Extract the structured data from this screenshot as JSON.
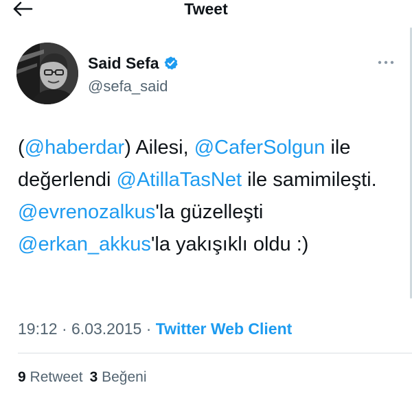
{
  "header": {
    "title": "Tweet",
    "back_icon": "arrow-left-icon"
  },
  "author": {
    "display_name": "Said Sefa",
    "handle": "@sefa_said",
    "verified_icon": "verified-badge-icon",
    "verified_color": "#1d9bf0",
    "more_icon": "more-horizontal-icon"
  },
  "tweet": {
    "segments": [
      {
        "text": "(",
        "mention": false
      },
      {
        "text": "@haberdar",
        "mention": true
      },
      {
        "text": ") Ailesi, ",
        "mention": false
      },
      {
        "text": "@CaferSolgun",
        "mention": true
      },
      {
        "text": " ile değerlendi ",
        "mention": false
      },
      {
        "text": "@AtillaTasNet",
        "mention": true
      },
      {
        "text": " ile samimileşti. ",
        "mention": false
      },
      {
        "text": "@evrenozalkus",
        "mention": true
      },
      {
        "text": "'la güzelleşti ",
        "mention": false
      },
      {
        "text": "@erkan_akkus",
        "mention": true
      },
      {
        "text": "'la yakışıklı oldu :)",
        "mention": false
      }
    ]
  },
  "meta": {
    "time": "19:12",
    "sep1": " · ",
    "date": "6.03.2015",
    "sep2": " · ",
    "source": "Twitter Web Client"
  },
  "stats": {
    "retweets_count": "9",
    "retweets_label": "Retweet",
    "likes_count": "3",
    "likes_label": "Beğeni"
  },
  "colors": {
    "accent": "#1d9bf0",
    "text": "#0f1419",
    "secondary": "#536471"
  }
}
